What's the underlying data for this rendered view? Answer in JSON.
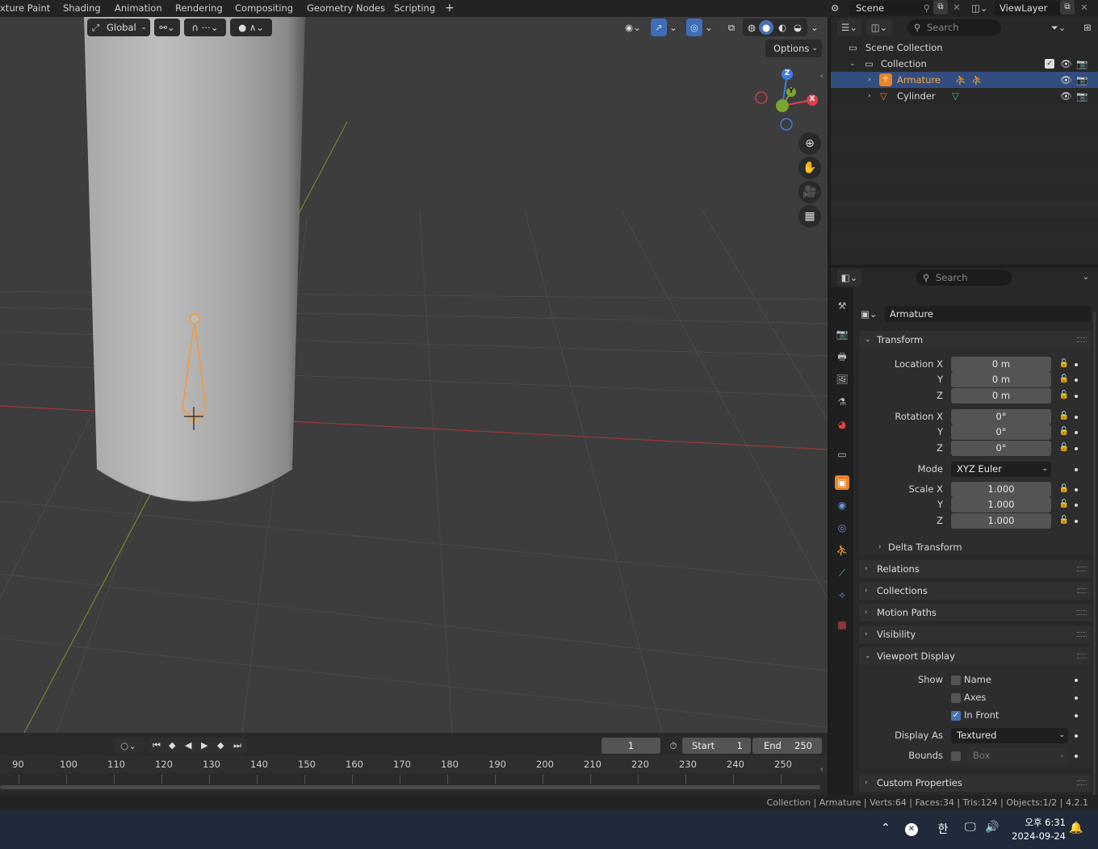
{
  "workspace_tabs": [
    "xture Paint",
    "Shading",
    "Animation",
    "Rendering",
    "Compositing",
    "Geometry Nodes",
    "Scripting",
    "+"
  ],
  "scene": {
    "name": "Scene",
    "view_layer": "ViewLayer"
  },
  "viewport": {
    "transform_orientation": "Global",
    "options_label": "Options",
    "gizmo_axes": {
      "x": "X",
      "y": "Y",
      "z": "Z"
    }
  },
  "outliner": {
    "search_placeholder": "Search",
    "items": [
      {
        "label": "Scene Collection"
      },
      {
        "label": "Collection"
      },
      {
        "label": "Armature"
      },
      {
        "label": "Cylinder"
      }
    ]
  },
  "properties": {
    "search_placeholder": "Search",
    "object_name": "Armature",
    "transform": {
      "title": "Transform",
      "location_label": "Location X",
      "rotation_label": "Rotation X",
      "scale_label": "Scale X",
      "y_label": "Y",
      "z_label": "Z",
      "mode_label": "Mode",
      "location": [
        "0 m",
        "0 m",
        "0 m"
      ],
      "rotation": [
        "0°",
        "0°",
        "0°"
      ],
      "mode": "XYZ Euler",
      "scale": [
        "1.000",
        "1.000",
        "1.000"
      ]
    },
    "delta_transform": "Delta Transform",
    "relations": "Relations",
    "collections": "Collections",
    "motion_paths": "Motion Paths",
    "visibility": "Visibility",
    "viewport_display": {
      "title": "Viewport Display",
      "show_label": "Show",
      "name_label": "Name",
      "axes_label": "Axes",
      "in_front_label": "In Front",
      "name_checked": false,
      "axes_checked": false,
      "in_front_checked": true,
      "display_as_label": "Display As",
      "display_as": "Textured",
      "bounds_label": "Bounds",
      "bounds_value": "Box"
    },
    "custom_properties": "Custom Properties"
  },
  "timeline": {
    "current_frame": "1",
    "start_label": "Start",
    "start": "1",
    "end_label": "End",
    "end": "250",
    "frame_labels": [
      "90",
      "100",
      "110",
      "120",
      "130",
      "140",
      "150",
      "160",
      "170",
      "180",
      "190",
      "200",
      "210",
      "220",
      "230",
      "240",
      "250"
    ]
  },
  "status_bar": "Collection | Armature | Verts:64 | Faces:34 | Tris:124 | Objects:1/2 | 4.2.1",
  "taskbar": {
    "ime": "한",
    "time": "오후 6:31",
    "date": "2024-09-24"
  }
}
